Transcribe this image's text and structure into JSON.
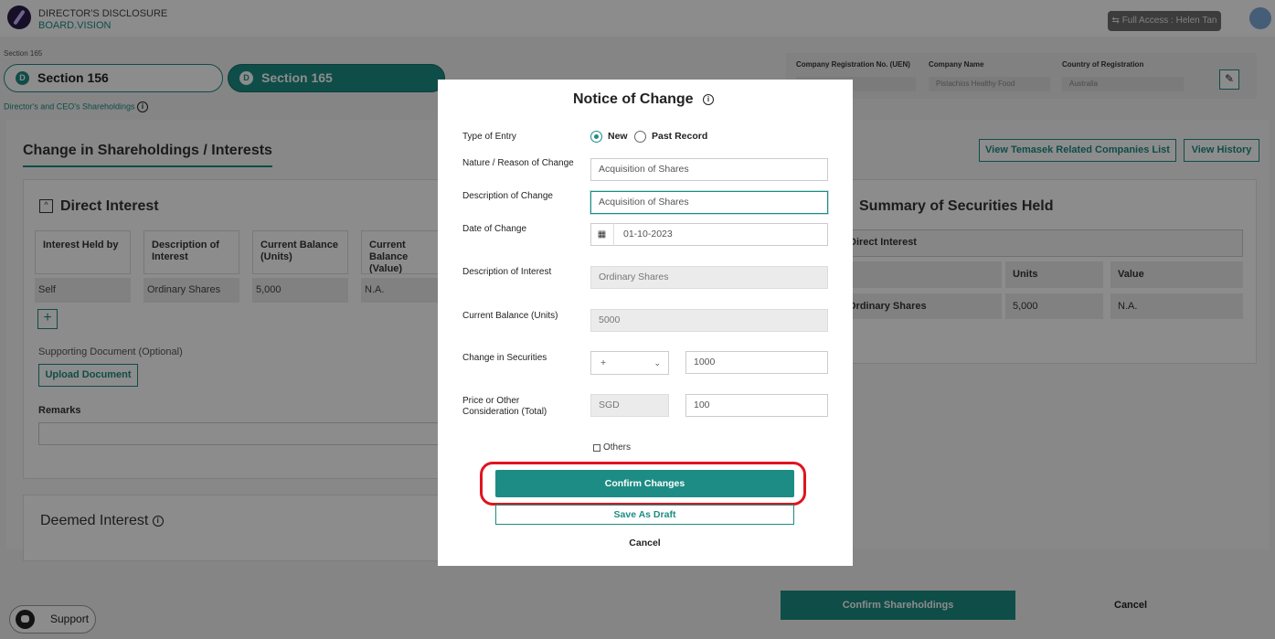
{
  "app": {
    "title": "DIRECTOR'S DISCLOSURE",
    "subtitle": "BOARD.VISION",
    "access_label": "Full Access : Helen Tan"
  },
  "breadcrumb": "Section 165",
  "section_tabs": [
    {
      "label": "Section 156",
      "badge": "D"
    },
    {
      "label": "Section 165",
      "badge": "D"
    }
  ],
  "sub_breadcrumb": "Director's and CEO's Shareholdings",
  "company_info": {
    "uen_label": "Company Registration No. (UEN)",
    "uen_value": "",
    "name_label": "Company Name",
    "name_value": "Pistachios Healthy Food",
    "country_label": "Country of Registration",
    "country_value": "Australia"
  },
  "page": {
    "heading": "Change in Shareholdings / Interests",
    "temasek_button": "View Temasek Related Companies List",
    "history_button": "View History"
  },
  "direct_interest": {
    "title": "Direct Interest",
    "columns": [
      "Interest Held by",
      "Description of Interest",
      "Current Balance (Units)",
      "Current Balance (Value)"
    ],
    "row": [
      "Self",
      "Ordinary Shares",
      "5,000",
      "N.A."
    ],
    "supporting_label": "Supporting Document (Optional)",
    "upload_button": "Upload Document",
    "remarks_label": "Remarks"
  },
  "deemed_interest": {
    "title": "Deemed Interest"
  },
  "summary": {
    "title": "Summary of Securities Held",
    "section_header": "Direct Interest",
    "col_units": "Units",
    "col_value": "Value",
    "row_desc": "Ordinary Shares",
    "row_units": "5,000",
    "row_value": "N.A."
  },
  "footer": {
    "confirm_button": "Confirm Shareholdings",
    "cancel_button": "Cancel",
    "support_label": "Support"
  },
  "modal": {
    "title": "Notice of Change",
    "type_label": "Type of Entry",
    "radio_new": "New",
    "radio_past": "Past Record",
    "nature_label": "Nature / Reason of Change",
    "nature_value": "Acquisition of Shares",
    "desc_change_label": "Description of Change",
    "desc_change_value": "Acquisition of Shares",
    "date_label": "Date of Change",
    "date_value": "01-10-2023",
    "desc_interest_label": "Description of Interest",
    "desc_interest_value": "Ordinary Shares",
    "balance_label": "Current Balance (Units)",
    "balance_value": "5000",
    "change_label": "Change in Securities",
    "change_sign": "+",
    "change_value": "1000",
    "price_label": "Price or Other Consideration (Total)",
    "currency": "SGD",
    "price_value": "100",
    "others_label": "Others",
    "confirm_button": "Confirm Changes",
    "draft_button": "Save As Draft",
    "cancel_button": "Cancel"
  },
  "colors": {
    "accent": "#1d8c84",
    "highlight": "#e0141e"
  }
}
